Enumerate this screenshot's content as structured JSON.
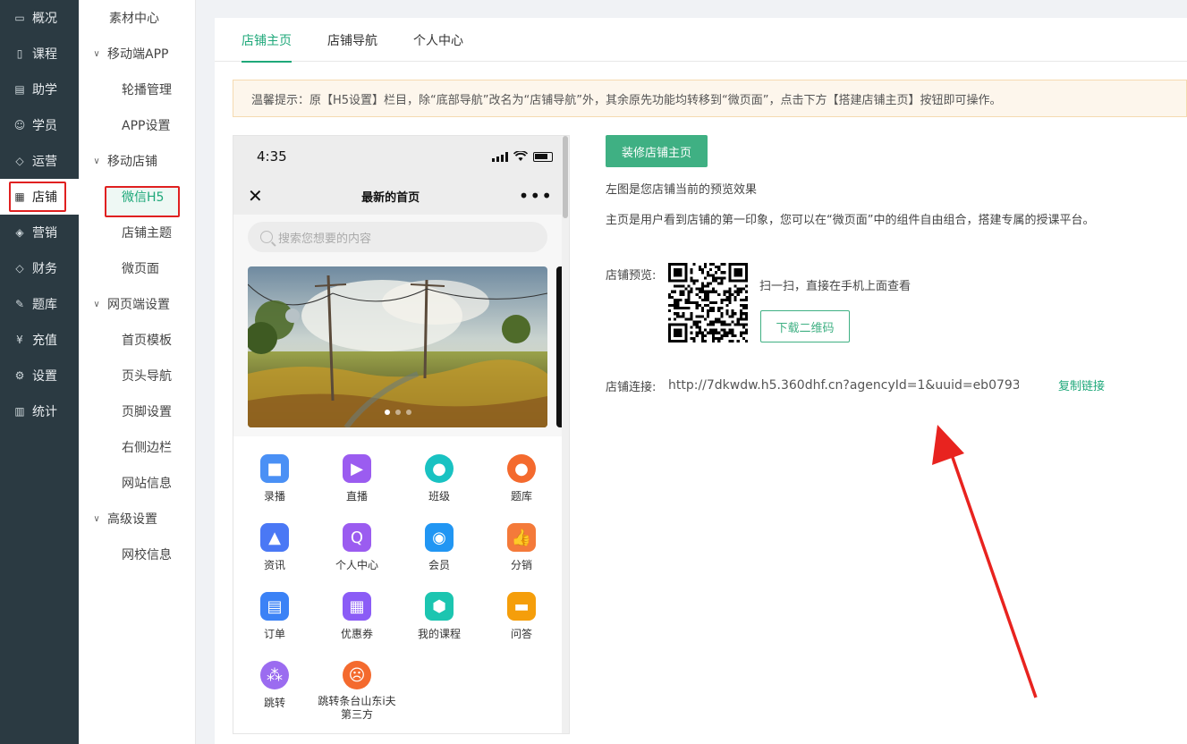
{
  "nav": {
    "items": [
      {
        "label": "概况",
        "icon": "overview-icon",
        "glyph": "▭"
      },
      {
        "label": "课程",
        "icon": "course-icon",
        "glyph": "▯"
      },
      {
        "label": "助学",
        "icon": "study-icon",
        "glyph": "▤"
      },
      {
        "label": "学员",
        "icon": "student-icon",
        "glyph": "☺"
      },
      {
        "label": "运营",
        "icon": "operate-icon",
        "glyph": "◇"
      },
      {
        "label": "店铺",
        "icon": "shop-icon",
        "glyph": "▦"
      },
      {
        "label": "营销",
        "icon": "marketing-icon",
        "glyph": "◈"
      },
      {
        "label": "财务",
        "icon": "finance-icon",
        "glyph": "◇"
      },
      {
        "label": "题库",
        "icon": "question-bank-icon",
        "glyph": "✎"
      },
      {
        "label": "充值",
        "icon": "recharge-icon",
        "glyph": "¥"
      },
      {
        "label": "设置",
        "icon": "settings-icon",
        "glyph": "⚙"
      },
      {
        "label": "统计",
        "icon": "stats-icon",
        "glyph": "▥"
      }
    ],
    "active_index": 5
  },
  "submenu": {
    "top": "素材中心",
    "groups": [
      {
        "label": "移动端APP",
        "items": [
          "轮播管理",
          "APP设置"
        ]
      },
      {
        "label": "移动店铺",
        "items": [
          "微信H5",
          "店铺主题",
          "微页面"
        ]
      },
      {
        "label": "网页端设置",
        "items": [
          "首页模板",
          "页头导航",
          "页脚设置",
          "右侧边栏",
          "网站信息"
        ]
      },
      {
        "label": "高级设置",
        "items": [
          "网校信息"
        ]
      }
    ],
    "active_item": "微信H5"
  },
  "tabs": [
    {
      "label": "店铺主页",
      "active": true
    },
    {
      "label": "店铺导航",
      "active": false
    },
    {
      "label": "个人中心",
      "active": false
    }
  ],
  "notice": "温馨提示：原【H5设置】栏目，除“底部导航”改名为“店铺导航”外，其余原先功能均转移到“微页面”，点击下方【搭建店铺主页】按钮即可操作。",
  "phone": {
    "time": "4:35",
    "title": "最新的首页",
    "search_placeholder": "搜索您想要的内容",
    "grid": [
      {
        "label": "录播",
        "icon": "video-record-icon",
        "color": "#4a90f5",
        "glyph": "■"
      },
      {
        "label": "直播",
        "icon": "live-tv-icon",
        "color": "#9b5cf0",
        "glyph": "▶"
      },
      {
        "label": "班级",
        "icon": "class-pin-icon",
        "color": "#19c2c2",
        "glyph": "●"
      },
      {
        "label": "题库",
        "icon": "question-planet-icon",
        "color": "#f46a2e",
        "glyph": "●"
      },
      {
        "label": "资讯",
        "icon": "news-house-icon",
        "color": "#4a78f5",
        "glyph": "▲"
      },
      {
        "label": "个人中心",
        "icon": "personal-center-icon",
        "color": "#9b5cf0",
        "glyph": "Q"
      },
      {
        "label": "会员",
        "icon": "member-camera-icon",
        "color": "#2196f3",
        "glyph": "◉"
      },
      {
        "label": "分销",
        "icon": "distribution-thumb-icon",
        "color": "#f47a3a",
        "glyph": "👍"
      },
      {
        "label": "订单",
        "icon": "order-book-icon",
        "color": "#3b82f6",
        "glyph": "▤"
      },
      {
        "label": "优惠券",
        "icon": "coupon-icon",
        "color": "#8b5cf6",
        "glyph": "▦"
      },
      {
        "label": "我的课程",
        "icon": "my-course-hex-icon",
        "color": "#1cc5b0",
        "glyph": "⬢"
      },
      {
        "label": "问答",
        "icon": "qa-folder-icon",
        "color": "#f59e0b",
        "glyph": "▬"
      },
      {
        "label": "跳转",
        "icon": "jump-dots-icon",
        "color": "#9b6cf0",
        "glyph": "⁂"
      },
      {
        "label": "跳转条台山东i夫第三方",
        "icon": "third-party-emoji-icon",
        "color": "#f46a2e",
        "glyph": "☹"
      }
    ]
  },
  "right": {
    "decorate_button": "装修店铺主页",
    "info1": "左图是您店铺当前的预览效果",
    "info2": "主页是用户看到店铺的第一印象，您可以在“微页面”中的组件自由组合，搭建专属的授课平台。",
    "preview_label": "店铺预览:",
    "scan_text": "扫一扫，直接在手机上面查看",
    "download_qr": "下载二维码",
    "link_label": "店铺连接:",
    "link_url": "http://7dkwdw.h5.360dhf.cn?agencyId=1&uuid=eb0793...",
    "copy_link": "复制链接"
  },
  "colors": {
    "accent": "#1fa87a",
    "nav_bg": "#2b3a42",
    "highlight": "#e02020"
  }
}
